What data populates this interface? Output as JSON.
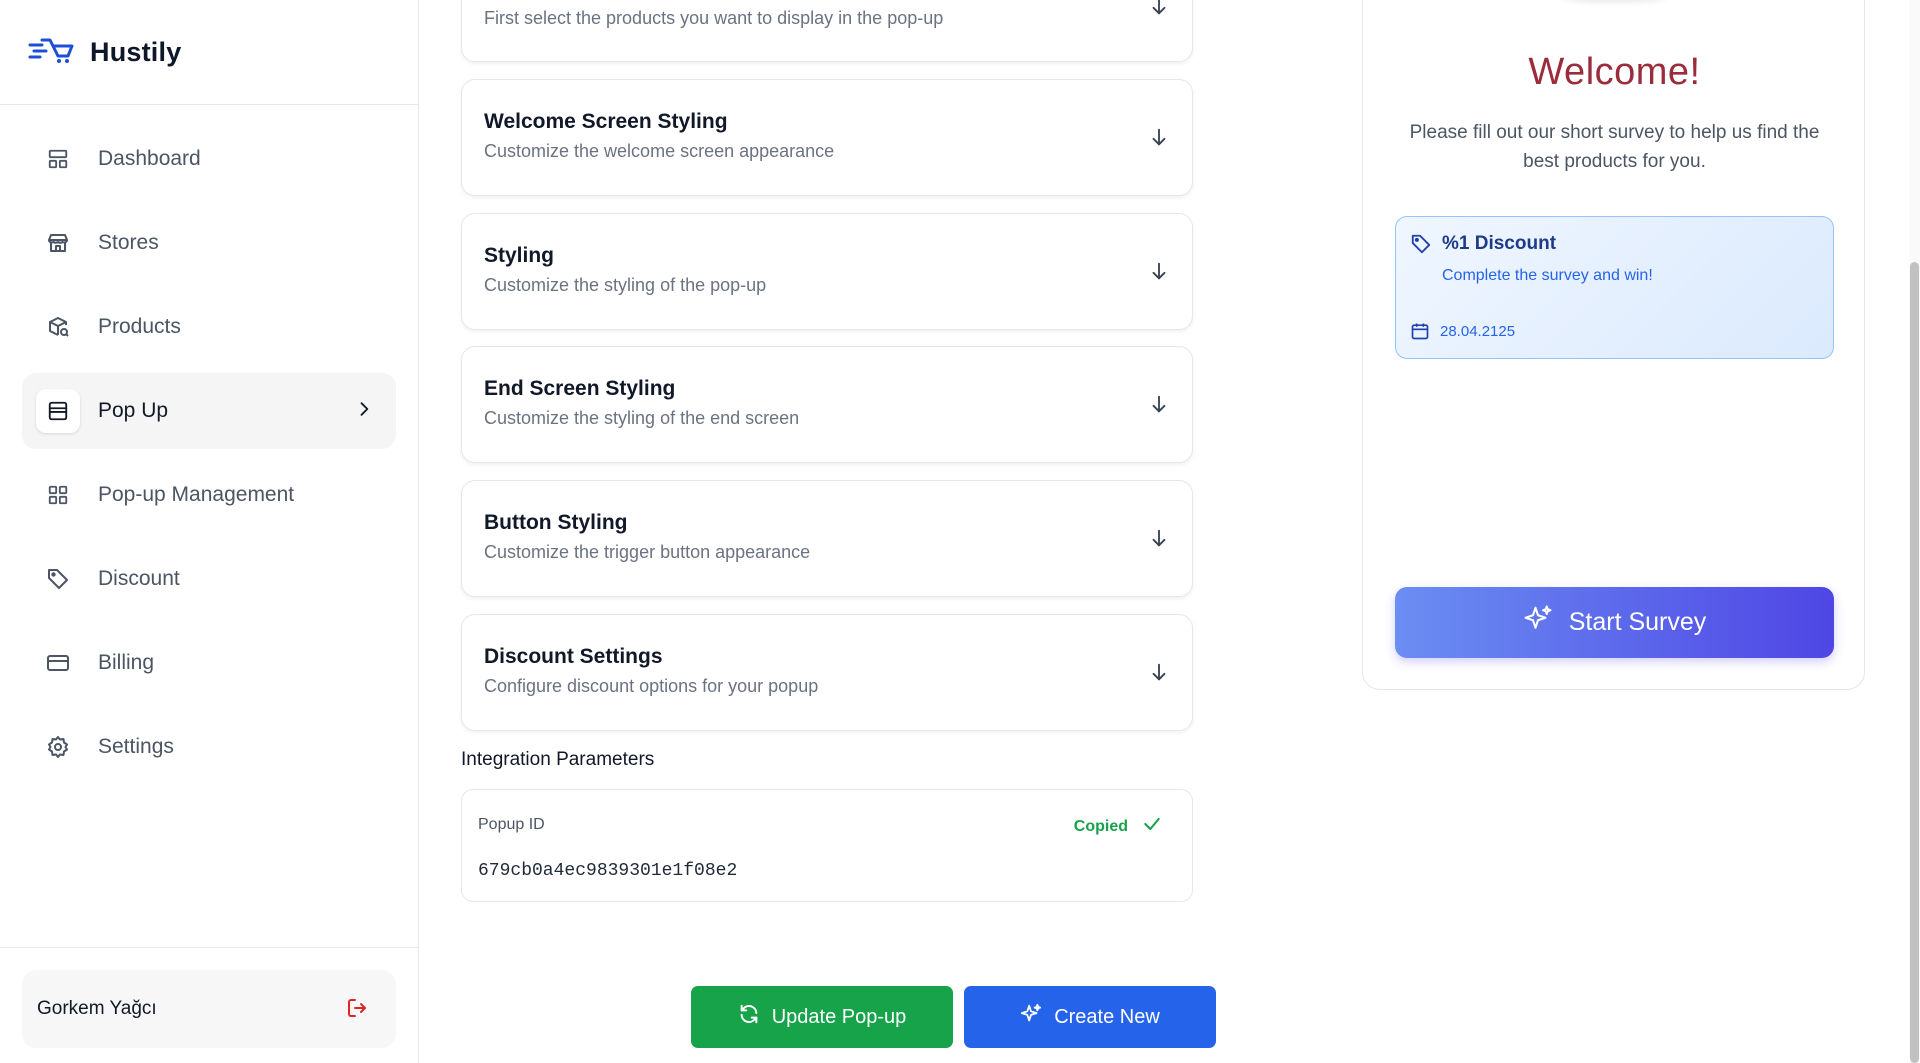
{
  "brand": {
    "name": "Hustily"
  },
  "sidebar": {
    "items": [
      {
        "label": "Dashboard",
        "icon": "layout-icon"
      },
      {
        "label": "Stores",
        "icon": "store-icon"
      },
      {
        "label": "Products",
        "icon": "package-search-icon"
      },
      {
        "label": "Pop Up",
        "icon": "popup-icon",
        "active": true
      },
      {
        "label": "Pop-up Management",
        "icon": "grid-icon"
      },
      {
        "label": "Discount",
        "icon": "tag-icon"
      },
      {
        "label": "Billing",
        "icon": "credit-card-icon"
      },
      {
        "label": "Settings",
        "icon": "gear-icon"
      }
    ],
    "user": {
      "name": "Gorkem Yağcı"
    }
  },
  "main": {
    "top_section": {
      "subtitle": "First select the products you want to display in the pop-up"
    },
    "sections": [
      {
        "title": "Welcome Screen Styling",
        "subtitle": "Customize the welcome screen appearance"
      },
      {
        "title": "Styling",
        "subtitle": "Customize the styling of the pop-up"
      },
      {
        "title": "End Screen Styling",
        "subtitle": "Customize the styling of the end screen"
      },
      {
        "title": "Button Styling",
        "subtitle": "Customize the trigger button appearance"
      },
      {
        "title": "Discount Settings",
        "subtitle": "Configure discount options for your popup"
      }
    ],
    "integration": {
      "title": "Integration Parameters",
      "label": "Popup ID",
      "status": "Copied",
      "value": "679cb0a4ec9839301e1f08e2"
    },
    "buttons": {
      "update": "Update Pop-up",
      "create": "Create New"
    }
  },
  "preview": {
    "title": "Welcome!",
    "description": "Please fill out our short survey to help us find the best products for you.",
    "discount": {
      "title": "%1 Discount",
      "subtitle": "Complete the survey and win!",
      "date": "28.04.2125"
    },
    "start_button": "Start Survey"
  },
  "colors": {
    "accent": "#2563eb",
    "success": "#16a34a",
    "welcome_title": "#9b2c3b",
    "logout": "#dc2626"
  }
}
